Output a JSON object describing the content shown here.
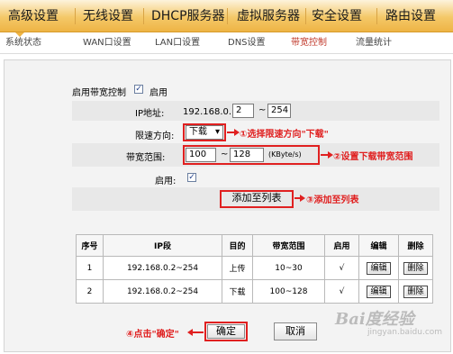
{
  "nav": {
    "items": [
      "高级设置",
      "无线设置",
      "DHCP服务器",
      "虚拟服务器",
      "安全设置",
      "路由设置"
    ]
  },
  "subnav": {
    "items": [
      "系统状态",
      "WAN口设置",
      "LAN口设置",
      "DNS设置",
      "带宽控制",
      "流量统计"
    ],
    "active": "带宽控制"
  },
  "form": {
    "enable_bw_label": "启用带宽控制",
    "enable_label": "启用",
    "enable_checked": true,
    "ip_label": "IP地址:",
    "ip_prefix": "192.168.0.",
    "ip_start": "2",
    "range_sep": "~",
    "ip_end": "254",
    "direction_label": "限速方向:",
    "direction_value": "下载",
    "bw_range_label": "带宽范围:",
    "bw_min": "100",
    "bw_max": "128",
    "bw_unit": "(KByte/s)",
    "rule_enable_label": "启用:",
    "rule_enable_checked": true,
    "add_button": "添加至列表"
  },
  "annotations": {
    "step1": "①选择限速方向\"下载\"",
    "step2": "②设置下载带宽范围",
    "step3": "③添加至列表",
    "step4": "④点击\"确定\""
  },
  "table": {
    "headers": [
      "序号",
      "IP段",
      "目的",
      "带宽范围",
      "启用",
      "编辑",
      "删除"
    ],
    "rows": [
      {
        "no": "1",
        "ip": "192.168.0.2~254",
        "dir": "上传",
        "range": "10~30",
        "enabled": "√",
        "edit": "编辑",
        "del": "删除"
      },
      {
        "no": "2",
        "ip": "192.168.0.2~254",
        "dir": "下载",
        "range": "100~128",
        "enabled": "√",
        "edit": "编辑",
        "del": "删除"
      }
    ]
  },
  "buttons": {
    "ok": "确定",
    "cancel": "取消"
  },
  "watermark": {
    "text": "Bai度经验",
    "sub": "jingyan.baidu.com"
  },
  "colors": {
    "nav_gold": "#eeb445",
    "annotation_red": "#e02020",
    "active_subnav": "#c0392b"
  }
}
